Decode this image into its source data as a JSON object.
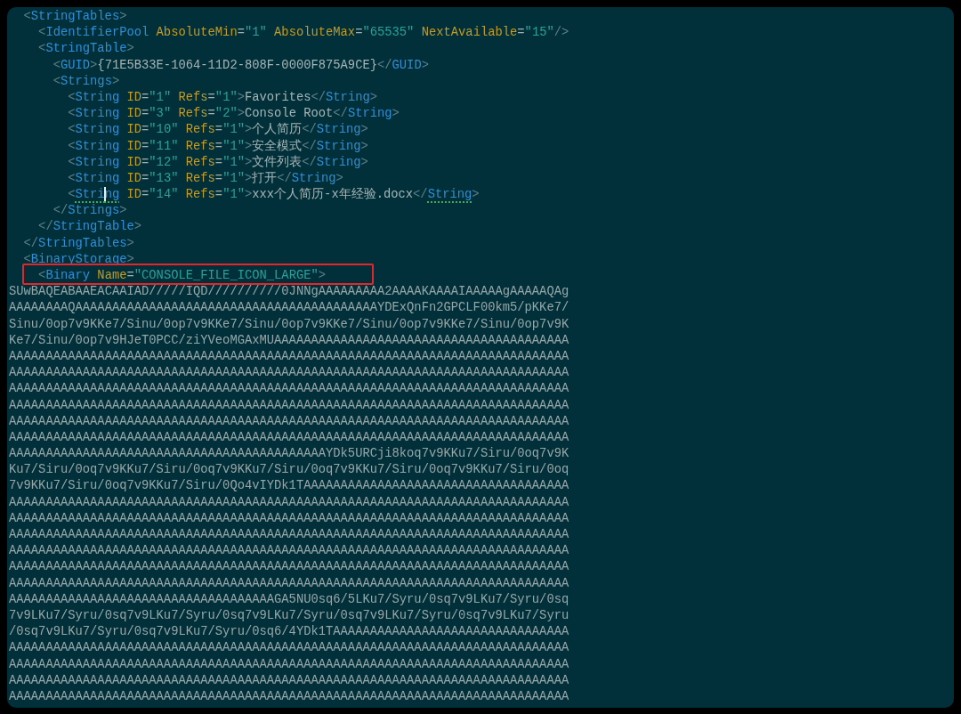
{
  "editor": {
    "xml": [
      {
        "tokens": [
          {
            "kind": "bracket",
            "text": "<"
          },
          {
            "kind": "tag",
            "text": "StringTables"
          },
          {
            "kind": "bracket",
            "text": ">"
          }
        ],
        "children": [
          {
            "tokens": [
              {
                "kind": "bracket",
                "text": "<"
              },
              {
                "kind": "tag",
                "text": "IdentifierPool"
              },
              {
                "kind": "attr",
                "text": " AbsoluteMin"
              },
              {
                "kind": "equals",
                "text": "="
              },
              {
                "kind": "value",
                "text": "\"1\""
              },
              {
                "kind": "attr",
                "text": " AbsoluteMax"
              },
              {
                "kind": "equals",
                "text": "="
              },
              {
                "kind": "value",
                "text": "\"65535\""
              },
              {
                "kind": "attr",
                "text": " NextAvailable"
              },
              {
                "kind": "equals",
                "text": "="
              },
              {
                "kind": "value",
                "text": "\"15\""
              },
              {
                "kind": "bracket",
                "text": "/>"
              }
            ]
          },
          {
            "tokens": [
              {
                "kind": "bracket",
                "text": "<"
              },
              {
                "kind": "tag",
                "text": "StringTable"
              },
              {
                "kind": "bracket",
                "text": ">"
              }
            ],
            "children": [
              {
                "tokens": [
                  {
                    "kind": "bracket",
                    "text": "<"
                  },
                  {
                    "kind": "tag",
                    "text": "GUID"
                  },
                  {
                    "kind": "bracket",
                    "text": ">"
                  },
                  {
                    "kind": "text",
                    "text": "{71E5B33E-1064-11D2-808F-0000F875A9CE}"
                  },
                  {
                    "kind": "bracket",
                    "text": "</"
                  },
                  {
                    "kind": "tag",
                    "text": "GUID"
                  },
                  {
                    "kind": "bracket",
                    "text": ">"
                  }
                ]
              },
              {
                "tokens": [
                  {
                    "kind": "bracket",
                    "text": "<"
                  },
                  {
                    "kind": "tag",
                    "text": "Strings"
                  },
                  {
                    "kind": "bracket",
                    "text": ">"
                  }
                ],
                "children": [
                  {
                    "tokens": [
                      {
                        "kind": "bracket",
                        "text": "<"
                      },
                      {
                        "kind": "tag",
                        "text": "String"
                      },
                      {
                        "kind": "attr",
                        "text": " ID"
                      },
                      {
                        "kind": "equals",
                        "text": "="
                      },
                      {
                        "kind": "value",
                        "text": "\"1\""
                      },
                      {
                        "kind": "attr",
                        "text": " Refs"
                      },
                      {
                        "kind": "equals",
                        "text": "="
                      },
                      {
                        "kind": "value",
                        "text": "\"1\""
                      },
                      {
                        "kind": "bracket",
                        "text": ">"
                      },
                      {
                        "kind": "text",
                        "text": "Favorites"
                      },
                      {
                        "kind": "bracket",
                        "text": "</"
                      },
                      {
                        "kind": "tag",
                        "text": "String"
                      },
                      {
                        "kind": "bracket",
                        "text": ">"
                      }
                    ]
                  },
                  {
                    "tokens": [
                      {
                        "kind": "bracket",
                        "text": "<"
                      },
                      {
                        "kind": "tag",
                        "text": "String"
                      },
                      {
                        "kind": "attr",
                        "text": " ID"
                      },
                      {
                        "kind": "equals",
                        "text": "="
                      },
                      {
                        "kind": "value",
                        "text": "\"3\""
                      },
                      {
                        "kind": "attr",
                        "text": " Refs"
                      },
                      {
                        "kind": "equals",
                        "text": "="
                      },
                      {
                        "kind": "value",
                        "text": "\"2\""
                      },
                      {
                        "kind": "bracket",
                        "text": ">"
                      },
                      {
                        "kind": "text",
                        "text": "Console Root"
                      },
                      {
                        "kind": "bracket",
                        "text": "</"
                      },
                      {
                        "kind": "tag",
                        "text": "String"
                      },
                      {
                        "kind": "bracket",
                        "text": ">"
                      }
                    ]
                  },
                  {
                    "tokens": [
                      {
                        "kind": "bracket",
                        "text": "<"
                      },
                      {
                        "kind": "tag",
                        "text": "String"
                      },
                      {
                        "kind": "attr",
                        "text": " ID"
                      },
                      {
                        "kind": "equals",
                        "text": "="
                      },
                      {
                        "kind": "value",
                        "text": "\"10\""
                      },
                      {
                        "kind": "attr",
                        "text": " Refs"
                      },
                      {
                        "kind": "equals",
                        "text": "="
                      },
                      {
                        "kind": "value",
                        "text": "\"1\""
                      },
                      {
                        "kind": "bracket",
                        "text": ">"
                      },
                      {
                        "kind": "text",
                        "text": "个人简历"
                      },
                      {
                        "kind": "bracket",
                        "text": "</"
                      },
                      {
                        "kind": "tag",
                        "text": "String"
                      },
                      {
                        "kind": "bracket",
                        "text": ">"
                      }
                    ]
                  },
                  {
                    "tokens": [
                      {
                        "kind": "bracket",
                        "text": "<"
                      },
                      {
                        "kind": "tag",
                        "text": "String"
                      },
                      {
                        "kind": "attr",
                        "text": " ID"
                      },
                      {
                        "kind": "equals",
                        "text": "="
                      },
                      {
                        "kind": "value",
                        "text": "\"11\""
                      },
                      {
                        "kind": "attr",
                        "text": " Refs"
                      },
                      {
                        "kind": "equals",
                        "text": "="
                      },
                      {
                        "kind": "value",
                        "text": "\"1\""
                      },
                      {
                        "kind": "bracket",
                        "text": ">"
                      },
                      {
                        "kind": "text",
                        "text": "安全模式"
                      },
                      {
                        "kind": "bracket",
                        "text": "</"
                      },
                      {
                        "kind": "tag",
                        "text": "String"
                      },
                      {
                        "kind": "bracket",
                        "text": ">"
                      }
                    ]
                  },
                  {
                    "tokens": [
                      {
                        "kind": "bracket",
                        "text": "<"
                      },
                      {
                        "kind": "tag",
                        "text": "String"
                      },
                      {
                        "kind": "attr",
                        "text": " ID"
                      },
                      {
                        "kind": "equals",
                        "text": "="
                      },
                      {
                        "kind": "value",
                        "text": "\"12\""
                      },
                      {
                        "kind": "attr",
                        "text": " Refs"
                      },
                      {
                        "kind": "equals",
                        "text": "="
                      },
                      {
                        "kind": "value",
                        "text": "\"1\""
                      },
                      {
                        "kind": "bracket",
                        "text": ">"
                      },
                      {
                        "kind": "text",
                        "text": "文件列表"
                      },
                      {
                        "kind": "bracket",
                        "text": "</"
                      },
                      {
                        "kind": "tag",
                        "text": "String"
                      },
                      {
                        "kind": "bracket",
                        "text": ">"
                      }
                    ]
                  },
                  {
                    "tokens": [
                      {
                        "kind": "bracket",
                        "text": "<"
                      },
                      {
                        "kind": "tag",
                        "text": "String"
                      },
                      {
                        "kind": "attr",
                        "text": " ID"
                      },
                      {
                        "kind": "equals",
                        "text": "="
                      },
                      {
                        "kind": "value",
                        "text": "\"13\""
                      },
                      {
                        "kind": "attr",
                        "text": " Refs"
                      },
                      {
                        "kind": "equals",
                        "text": "="
                      },
                      {
                        "kind": "value",
                        "text": "\"1\""
                      },
                      {
                        "kind": "bracket",
                        "text": ">"
                      },
                      {
                        "kind": "text",
                        "text": "打开"
                      },
                      {
                        "kind": "bracket",
                        "text": "</"
                      },
                      {
                        "kind": "tag",
                        "text": "String"
                      },
                      {
                        "kind": "bracket",
                        "text": ">"
                      }
                    ]
                  },
                  {
                    "tokens": [
                      {
                        "kind": "bracket",
                        "text": "<"
                      },
                      {
                        "kind": "tag",
                        "text": "Stri",
                        "underlined": true
                      },
                      {
                        "kind": "cursor"
                      },
                      {
                        "kind": "tag",
                        "text": "ng",
                        "underlined": true
                      },
                      {
                        "kind": "attr",
                        "text": " ID"
                      },
                      {
                        "kind": "equals",
                        "text": "="
                      },
                      {
                        "kind": "value",
                        "text": "\"14\""
                      },
                      {
                        "kind": "attr",
                        "text": " Refs"
                      },
                      {
                        "kind": "equals",
                        "text": "="
                      },
                      {
                        "kind": "value",
                        "text": "\"1\""
                      },
                      {
                        "kind": "bracket",
                        "text": ">"
                      },
                      {
                        "kind": "text",
                        "text": "xxx个人简历-x年经验.docx"
                      },
                      {
                        "kind": "bracket",
                        "text": "</"
                      },
                      {
                        "kind": "tag",
                        "text": "String",
                        "underlined": true
                      },
                      {
                        "kind": "bracket",
                        "text": ">"
                      }
                    ]
                  }
                ],
                "close": [
                  {
                    "kind": "bracket",
                    "text": "</"
                  },
                  {
                    "kind": "tag",
                    "text": "Strings"
                  },
                  {
                    "kind": "bracket",
                    "text": ">"
                  }
                ]
              }
            ],
            "close": [
              {
                "kind": "bracket",
                "text": "</"
              },
              {
                "kind": "tag",
                "text": "StringTable"
              },
              {
                "kind": "bracket",
                "text": ">"
              }
            ]
          }
        ],
        "close": [
          {
            "kind": "bracket",
            "text": "</"
          },
          {
            "kind": "tag",
            "text": "StringTables"
          },
          {
            "kind": "bracket",
            "text": ">"
          }
        ]
      },
      {
        "tokens": [
          {
            "kind": "bracket",
            "text": "<"
          },
          {
            "kind": "tag",
            "text": "BinaryStorage"
          },
          {
            "kind": "bracket",
            "text": ">"
          }
        ],
        "children": [
          {
            "highlighted": true,
            "tokens": [
              {
                "kind": "bracket",
                "text": "<"
              },
              {
                "kind": "tag",
                "text": "Binary"
              },
              {
                "kind": "attr",
                "text": " Name"
              },
              {
                "kind": "equals",
                "text": "="
              },
              {
                "kind": "value",
                "text": "\"CONSOLE_FILE_ICON_LARGE\""
              },
              {
                "kind": "bracket",
                "text": ">"
              }
            ]
          }
        ]
      }
    ],
    "binary_data": [
      "SUwBAQEABAAEACAAIAD/////IQD//////////0JNNgAAAAAAAAA2AAAAKAAAAIAAAAAgAAAAAQAg",
      "AAAAAAAAQAAAAAAAAAAAAAAAAAAAAAAAAAAAAAAAAAAAAAAAAAYDExQnFn2GPCLF00km5/pKKe7/",
      "Sinu/0op7v9KKe7/Sinu/0op7v9KKe7/Sinu/0op7v9KKe7/Sinu/0op7v9KKe7/Sinu/0op7v9K",
      "Ke7/Sinu/0op7v9HJeT0PCC/ziYVeoMGAxMUAAAAAAAAAAAAAAAAAAAAAAAAAAAAAAAAAAAAAAAA",
      "AAAAAAAAAAAAAAAAAAAAAAAAAAAAAAAAAAAAAAAAAAAAAAAAAAAAAAAAAAAAAAAAAAAAAAAAAAAA",
      "AAAAAAAAAAAAAAAAAAAAAAAAAAAAAAAAAAAAAAAAAAAAAAAAAAAAAAAAAAAAAAAAAAAAAAAAAAAA",
      "AAAAAAAAAAAAAAAAAAAAAAAAAAAAAAAAAAAAAAAAAAAAAAAAAAAAAAAAAAAAAAAAAAAAAAAAAAAA",
      "AAAAAAAAAAAAAAAAAAAAAAAAAAAAAAAAAAAAAAAAAAAAAAAAAAAAAAAAAAAAAAAAAAAAAAAAAAAA",
      "AAAAAAAAAAAAAAAAAAAAAAAAAAAAAAAAAAAAAAAAAAAAAAAAAAAAAAAAAAAAAAAAAAAAAAAAAAAA",
      "AAAAAAAAAAAAAAAAAAAAAAAAAAAAAAAAAAAAAAAAAAAAAAAAAAAAAAAAAAAAAAAAAAAAAAAAAAAA",
      "AAAAAAAAAAAAAAAAAAAAAAAAAAAAAAAAAAAAAAAAAAAYDk5URCji8koq7v9KKu7/Siru/0oq7v9K",
      "Ku7/Siru/0oq7v9KKu7/Siru/0oq7v9KKu7/Siru/0oq7v9KKu7/Siru/0oq7v9KKu7/Siru/0oq",
      "7v9KKu7/Siru/0oq7v9KKu7/Siru/0Qo4vIYDk1TAAAAAAAAAAAAAAAAAAAAAAAAAAAAAAAAAAAA",
      "AAAAAAAAAAAAAAAAAAAAAAAAAAAAAAAAAAAAAAAAAAAAAAAAAAAAAAAAAAAAAAAAAAAAAAAAAAAA",
      "AAAAAAAAAAAAAAAAAAAAAAAAAAAAAAAAAAAAAAAAAAAAAAAAAAAAAAAAAAAAAAAAAAAAAAAAAAAA",
      "AAAAAAAAAAAAAAAAAAAAAAAAAAAAAAAAAAAAAAAAAAAAAAAAAAAAAAAAAAAAAAAAAAAAAAAAAAAA",
      "AAAAAAAAAAAAAAAAAAAAAAAAAAAAAAAAAAAAAAAAAAAAAAAAAAAAAAAAAAAAAAAAAAAAAAAAAAAA",
      "AAAAAAAAAAAAAAAAAAAAAAAAAAAAAAAAAAAAAAAAAAAAAAAAAAAAAAAAAAAAAAAAAAAAAAAAAAAA",
      "AAAAAAAAAAAAAAAAAAAAAAAAAAAAAAAAAAAAAAAAAAAAAAAAAAAAAAAAAAAAAAAAAAAAAAAAAAAA",
      "AAAAAAAAAAAAAAAAAAAAAAAAAAAAAAAAAAAAGA5NU0sq6/5LKu7/Syru/0sq7v9LKu7/Syru/0sq",
      "7v9LKu7/Syru/0sq7v9LKu7/Syru/0sq7v9LKu7/Syru/0sq7v9LKu7/Syru/0sq7v9LKu7/Syru",
      "/0sq7v9LKu7/Syru/0sq7v9LKu7/Syru/0sq6/4YDk1TAAAAAAAAAAAAAAAAAAAAAAAAAAAAAAAA",
      "AAAAAAAAAAAAAAAAAAAAAAAAAAAAAAAAAAAAAAAAAAAAAAAAAAAAAAAAAAAAAAAAAAAAAAAAAAAA",
      "AAAAAAAAAAAAAAAAAAAAAAAAAAAAAAAAAAAAAAAAAAAAAAAAAAAAAAAAAAAAAAAAAAAAAAAAAAAA",
      "AAAAAAAAAAAAAAAAAAAAAAAAAAAAAAAAAAAAAAAAAAAAAAAAAAAAAAAAAAAAAAAAAAAAAAAAAAAA",
      "AAAAAAAAAAAAAAAAAAAAAAAAAAAAAAAAAAAAAAAAAAAAAAAAAAAAAAAAAAAAAAAAAAAAAAAAAAAA"
    ]
  }
}
